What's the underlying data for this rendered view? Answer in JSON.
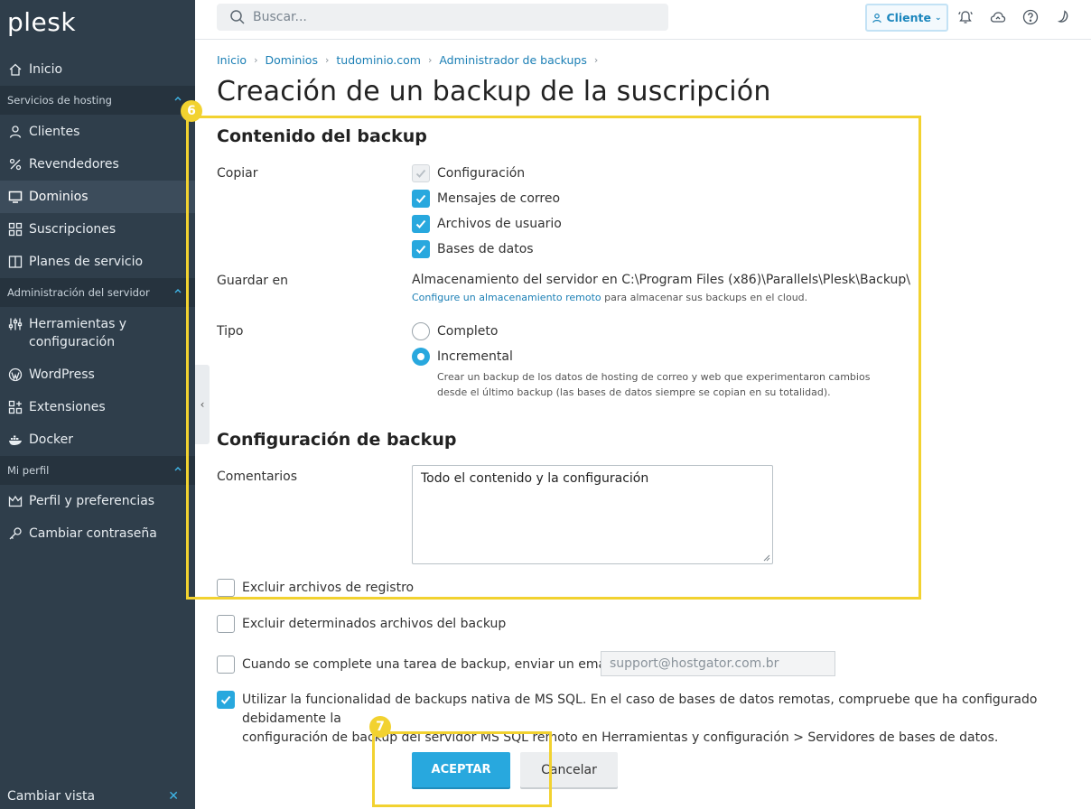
{
  "app": {
    "logo": "plesk"
  },
  "search": {
    "placeholder": "Buscar..."
  },
  "topbar": {
    "client_label": "Cliente"
  },
  "sidebar": {
    "home": "Inicio",
    "section_hosting": "Servicios de hosting",
    "hosting_items": [
      "Clientes",
      "Revendedores",
      "Dominios",
      "Suscripciones",
      "Planes de servicio"
    ],
    "section_server": "Administración del servidor",
    "server_items": [
      "Herramientas y configuración",
      "WordPress",
      "Extensiones",
      "Docker"
    ],
    "section_profile": "Mi perfil",
    "profile_items": [
      "Perfil y preferencias",
      "Cambiar contraseña"
    ],
    "switch_view": "Cambiar vista"
  },
  "breadcrumb": [
    "Inicio",
    "Dominios",
    "tudominio.com",
    "Administrador de backups"
  ],
  "page_title": "Creación de un backup de la suscripción",
  "content": {
    "heading": "Contenido del backup",
    "copy_label": "Copiar",
    "copy_options": [
      {
        "label": "Configuración",
        "state": "checked-disabled"
      },
      {
        "label": "Mensajes de correo",
        "state": "checked"
      },
      {
        "label": "Archivos de usuario",
        "state": "checked"
      },
      {
        "label": "Bases de datos",
        "state": "checked"
      }
    ],
    "save_label": "Guardar en",
    "save_value": "Almacenamiento del servidor en C:\\Program Files (x86)\\Parallels\\Plesk\\Backup\\",
    "remote_link": "Configure un almacenamiento remoto",
    "remote_suffix": " para almacenar sus backups en el cloud.",
    "type_label": "Tipo",
    "type_options": [
      {
        "label": "Completo",
        "selected": false
      },
      {
        "label": "Incremental",
        "selected": true
      }
    ],
    "incremental_hint_1": "Crear un backup de los datos de hosting de correo y web que experimentaron cambios",
    "incremental_hint_2": "desde el último backup (las bases de datos siempre se copian en su totalidad)."
  },
  "config": {
    "heading": "Configuración de backup",
    "comments_label": "Comentarios",
    "comments_value": "Todo el contenido y la configuración",
    "exclude_logs": "Excluir archivos de registro",
    "exclude_files": "Excluir determinados archivos del backup",
    "email_notify": "Cuando se complete una tarea de backup, enviar un email a",
    "email_placeholder": "support@hostgator.com.br",
    "mssql_line1": "Utilizar la funcionalidad de backups nativa de MS SQL. En el caso de bases de datos remotas, compruebe que ha configurado debidamente la",
    "mssql_line2": "configuración de backup del servidor MS SQL remoto en Herramientas y configuración > Servidores de bases de datos."
  },
  "buttons": {
    "ok": "ACEPTAR",
    "cancel": "Cancelar"
  },
  "annotations": {
    "step6": "6",
    "step7": "7"
  },
  "colors": {
    "accent": "#28a8de",
    "sidebar": "#2f3e4b",
    "highlight": "#f2d230",
    "link": "#1b7fb5"
  }
}
